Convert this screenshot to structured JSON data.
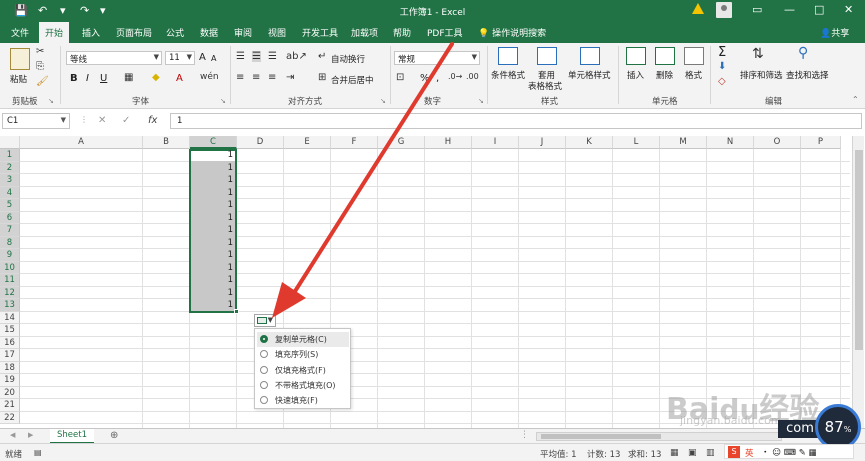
{
  "title_bar": {
    "title": "工作簿1 - Excel",
    "save_icon": "save-icon",
    "undo_icon": "undo-icon",
    "redo_icon": "redo-icon",
    "customize_icon": "customize-icon",
    "warning_icon": "warning-icon",
    "account_icon": "account-icon",
    "window_buttons": [
      "—",
      "□",
      "✕"
    ]
  },
  "tabs": [
    {
      "label": "文件"
    },
    {
      "label": "开始"
    },
    {
      "label": "插入"
    },
    {
      "label": "页面布局"
    },
    {
      "label": "公式"
    },
    {
      "label": "数据"
    },
    {
      "label": "审阅"
    },
    {
      "label": "视图"
    },
    {
      "label": "开发工具"
    },
    {
      "label": "加载项"
    },
    {
      "label": "帮助"
    },
    {
      "label": "PDF工具"
    }
  ],
  "active_tab": "开始",
  "tell_me": "操作说明搜索",
  "share": "共享",
  "ribbon": {
    "clipboard": {
      "paste": "粘贴",
      "group": "剪贴板"
    },
    "font": {
      "name": "等线",
      "size": "11",
      "bold": "B",
      "italic": "I",
      "underline": "U",
      "grow": "A",
      "shrink": "A",
      "group": "字体"
    },
    "alignment": {
      "wrap": "自动换行",
      "merge": "合并后居中",
      "group": "对齐方式"
    },
    "number": {
      "format": "常规",
      "percent": "%",
      "comma": ",",
      "group": "数字"
    },
    "styles": {
      "conditional": "条件格式",
      "table_line1": "套用",
      "table_line2": "表格格式",
      "cell_styles": "单元格样式",
      "group": "样式"
    },
    "cells": {
      "insert": "插入",
      "delete": "删除",
      "format": "格式",
      "group": "单元格"
    },
    "editing": {
      "sigma": "Σ",
      "sort_filter": "排序和筛选",
      "find_select": "查找和选择",
      "group": "编辑"
    }
  },
  "formula_bar": {
    "name_box": "C1",
    "cancel": "✕",
    "confirm": "✓",
    "fx": "fx",
    "value": "1"
  },
  "grid": {
    "columns": [
      "A",
      "B",
      "C",
      "D",
      "E",
      "F",
      "G",
      "H",
      "I",
      "J",
      "K",
      "L",
      "M",
      "N",
      "O",
      "P"
    ],
    "rows": [
      "1",
      "2",
      "3",
      "4",
      "5",
      "6",
      "7",
      "8",
      "9",
      "10",
      "11",
      "12",
      "13",
      "14",
      "15",
      "16",
      "17",
      "18",
      "19",
      "20",
      "21",
      "22"
    ],
    "selected_column": "C",
    "c_values": [
      "1",
      "1",
      "1",
      "1",
      "1",
      "1",
      "1",
      "1",
      "1",
      "1",
      "1",
      "1",
      "1"
    ]
  },
  "autofill_menu": {
    "button_icon": "autofill-options-icon",
    "items": [
      {
        "label": "复制单元格(C)",
        "checked": true
      },
      {
        "label": "填充序列(S)",
        "checked": false
      },
      {
        "label": "仅填充格式(F)",
        "checked": false
      },
      {
        "label": "不带格式填充(O)",
        "checked": false
      },
      {
        "label": "快速填充(F)",
        "checked": false
      }
    ]
  },
  "sheets": {
    "tabs": [
      {
        "label": "Sheet1"
      }
    ],
    "add": "⊕",
    "prev": "◀",
    "next": "▶"
  },
  "status_bar": {
    "ready": "就绪",
    "average": "平均值: 1",
    "count": "计数: 13",
    "sum": "求和: 13"
  },
  "watermark": {
    "brand": "Bai",
    "brand2": "经验",
    "url": "jingyan.baidu.com",
    "badge_value": "87",
    "badge_unit": "%",
    "com": "com",
    "ime_label": "英"
  },
  "colors": {
    "excel_green": "#217346",
    "arrow_red": "#e03a2e"
  }
}
